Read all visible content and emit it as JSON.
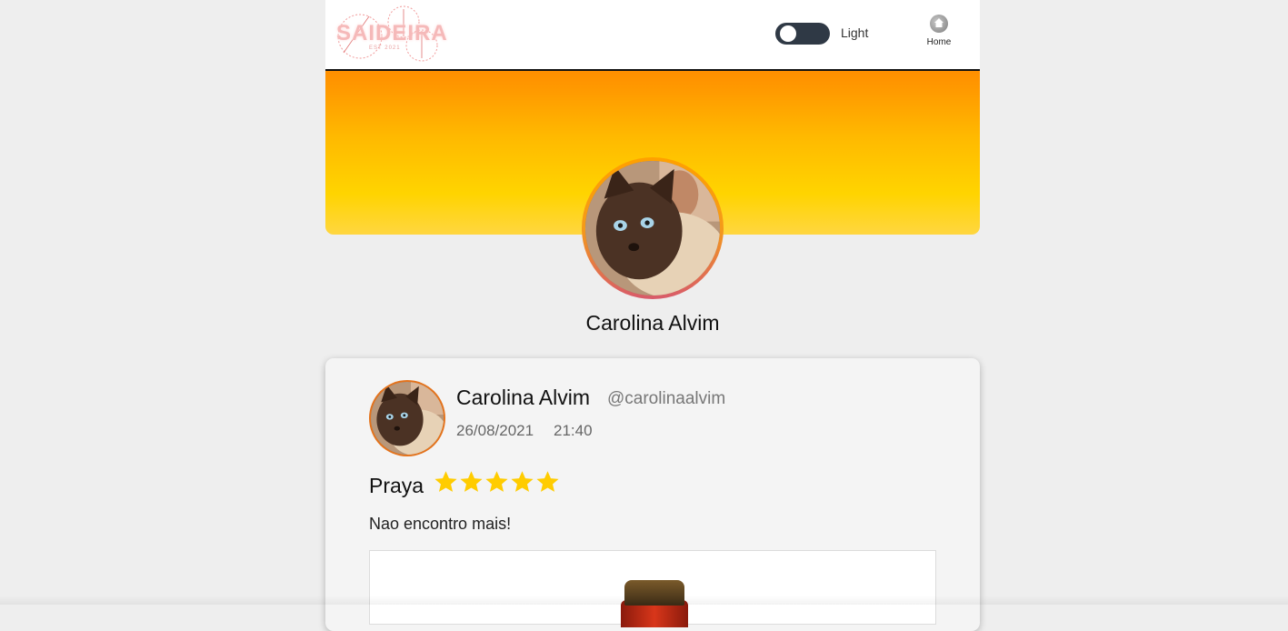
{
  "header": {
    "logo_text": "SAIDEIRA",
    "logo_sub": "EST 2021",
    "theme_toggle_label": "Light",
    "home_label": "Home"
  },
  "profile": {
    "name": "Carolina Alvim"
  },
  "post": {
    "author": "Carolina Alvim",
    "handle": "@carolinaalvim",
    "date": "26/08/2021",
    "time": "21:40",
    "beer": "Praya",
    "rating": 5,
    "text": "Nao encontro mais!"
  },
  "colors": {
    "banner_top": "#ff8f00",
    "banner_bottom": "#ffd640",
    "star": "#ffcc00",
    "toggle_bg": "#2f3945",
    "avatar_ring": "#e4731c"
  },
  "icons": {
    "home": "home-icon",
    "star": "star-icon"
  }
}
